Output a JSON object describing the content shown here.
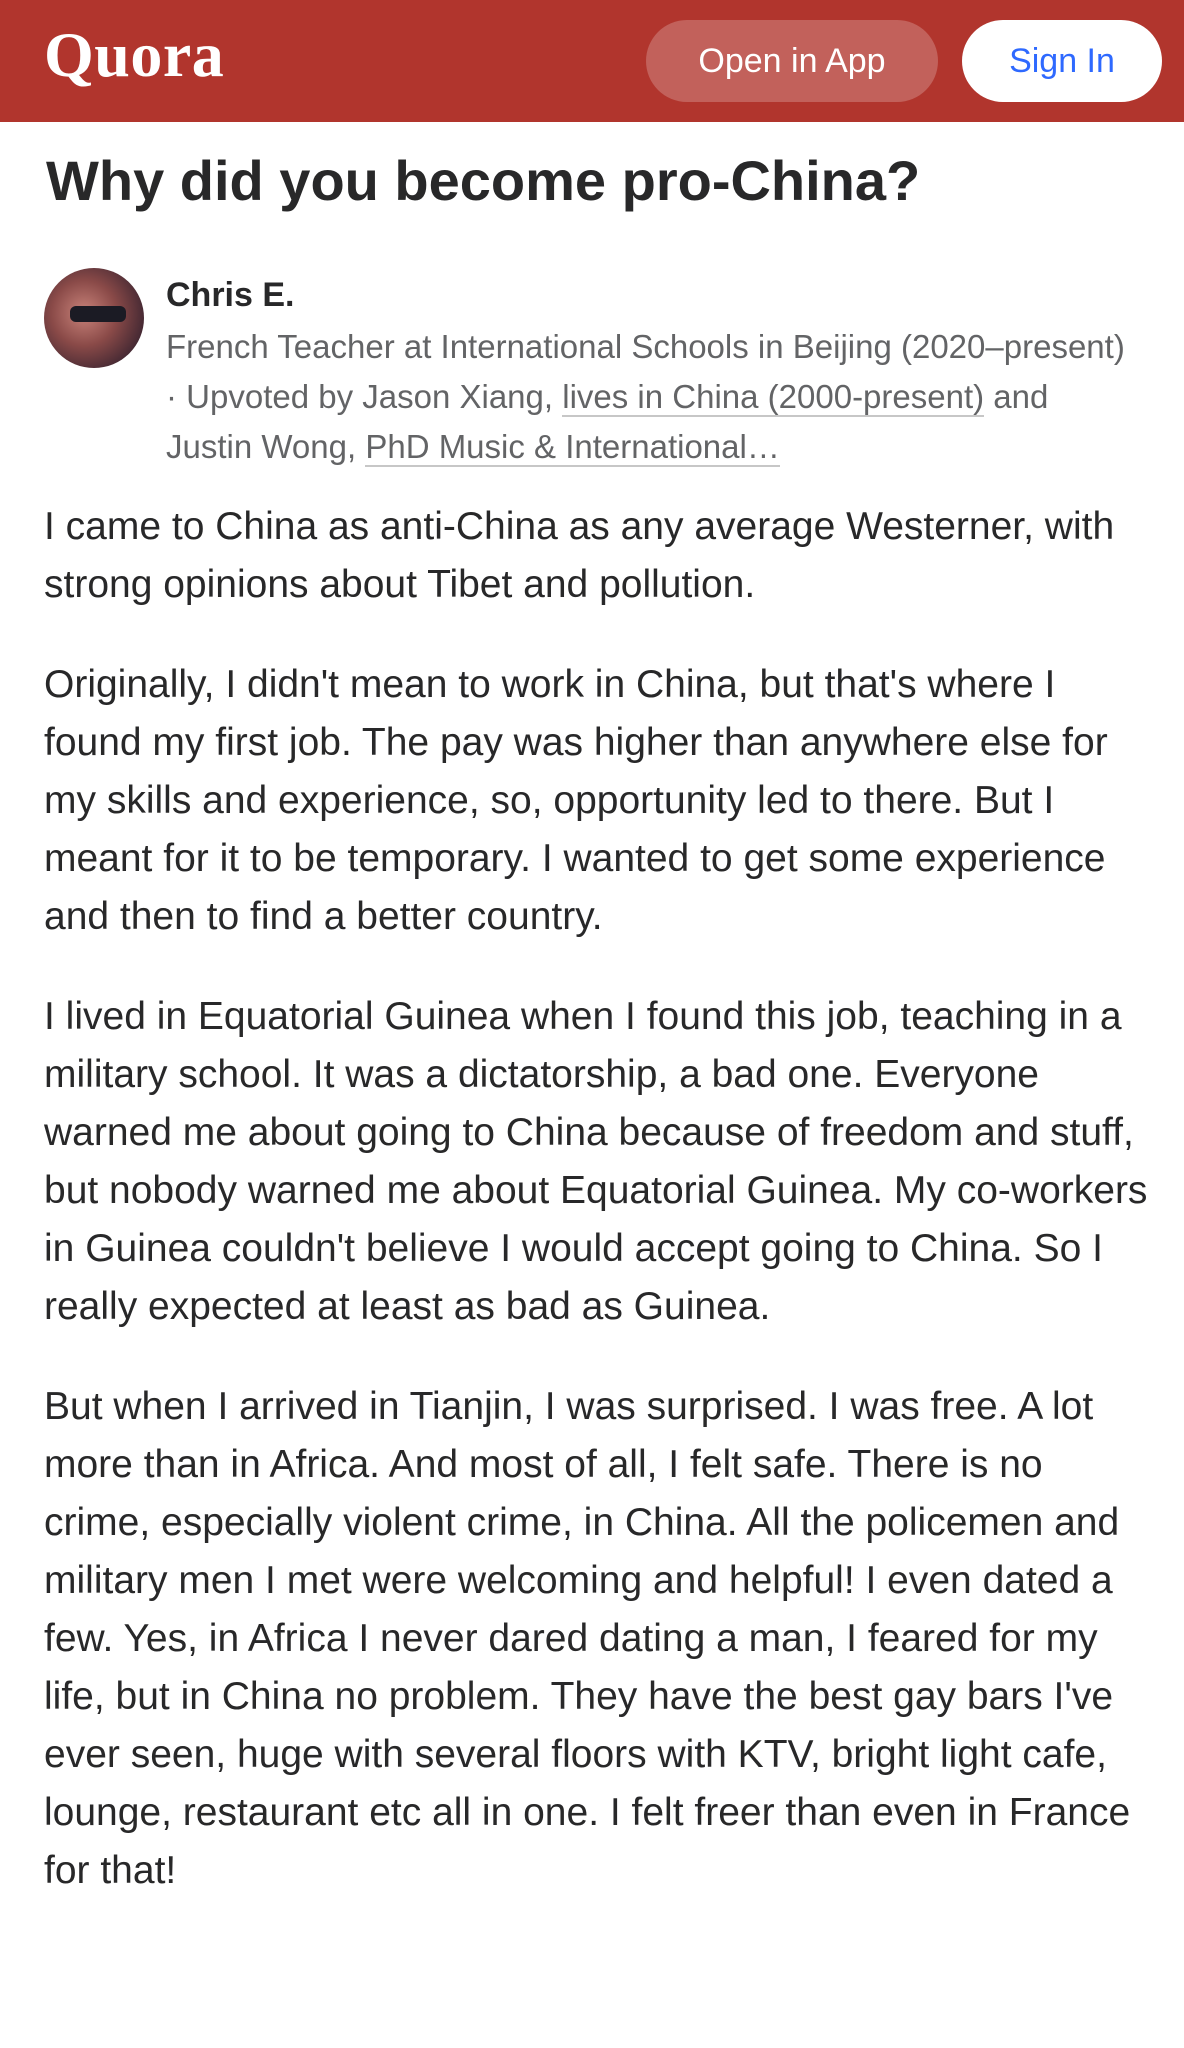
{
  "header": {
    "logo": "Quora",
    "open_in_app": "Open in App",
    "sign_in": "Sign In",
    "bar_color": "#b1352d",
    "signin_color": "#2e69ff"
  },
  "question": {
    "title": "Why did you become pro-China?"
  },
  "author": {
    "name": "Chris E.",
    "cred_1": "French Teacher at International Schools in Beijing (2020–present)",
    "sep_1": " · Upvoted by Jason Xiang, ",
    "upvoter_1_cred": "lives in China (2000-present)",
    "sep_2": " and Justin Wong, ",
    "upvoter_2_cred": "PhD Music & International…"
  },
  "answer": {
    "paragraphs": [
      "I came to China as anti-China as any average Westerner, with strong opinions about Tibet and pollution.",
      "Originally, I didn't mean to work in China, but that's where I found my first job. The pay was higher than anywhere else for my skills and experience, so, opportunity led to there. But I meant for it to be temporary. I wanted to get some experience and then to find a better country.",
      "I lived in Equatorial Guinea when I found this job, teaching in a military school. It was a dictatorship, a bad one. Everyone warned me about going to China because of freedom and stuff, but nobody warned me about Equatorial Guinea. My co-workers in Guinea couldn't believe I would accept going to China. So I really expected at least as bad as Guinea.",
      "But when I arrived in Tianjin, I was surprised. I was free. A lot more than in Africa. And most of all, I felt safe. There is no crime, especially violent crime, in China. All the policemen and military men I met were welcoming and helpful! I even dated a few. Yes, in Africa I never dared dating a man, I feared for my life, but in China no problem. They have the best gay bars I've ever seen, huge with several floors with KTV, bright light cafe, lounge, restaurant etc all in one. I felt freer than even in France for that!"
    ]
  }
}
